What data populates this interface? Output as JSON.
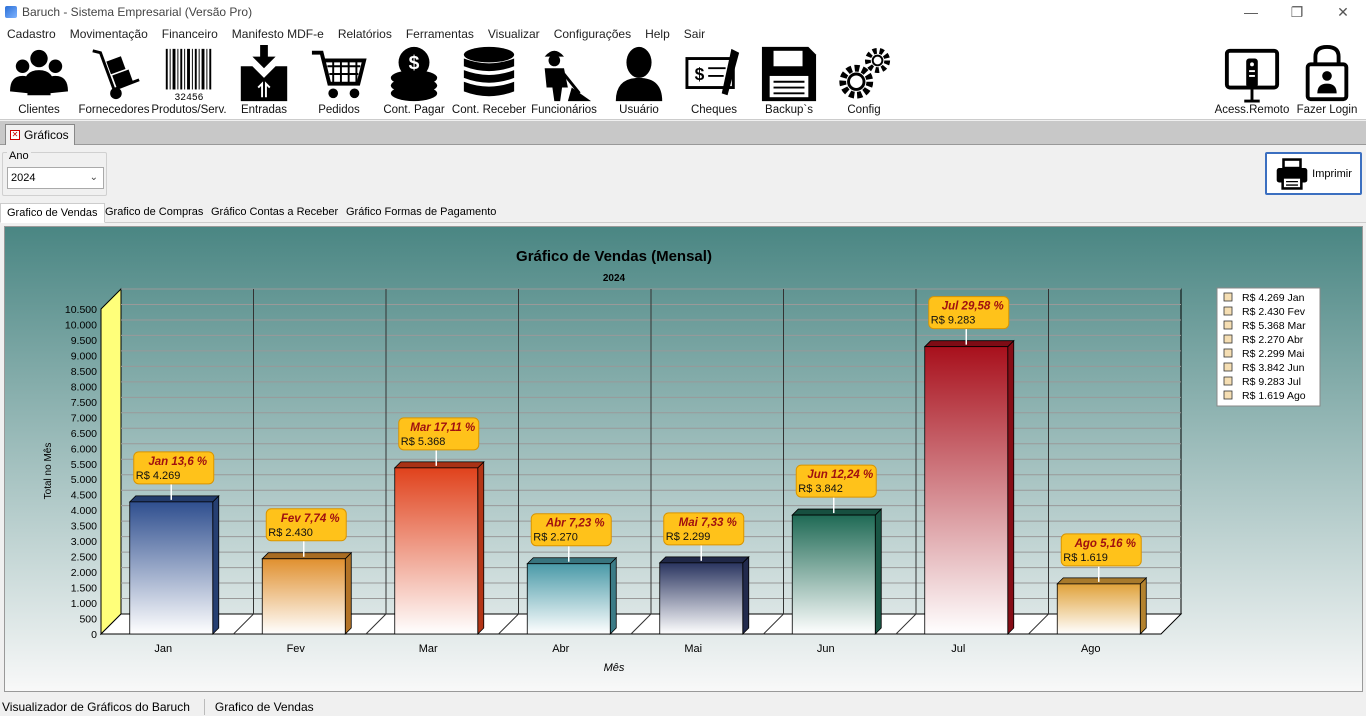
{
  "window": {
    "title": "Baruch - Sistema Empresarial (Versão Pro)"
  },
  "menu": [
    "Cadastro",
    "Movimentação",
    "Financeiro",
    "Manifesto MDF-e",
    "Relatórios",
    "Ferramentas",
    "Visualizar",
    "Configurações",
    "Help",
    "Sair"
  ],
  "toolbar": {
    "clientes": "Clientes",
    "fornecedores": "Fornecedores",
    "produtos": "Produtos/Serv.",
    "barcode_digits": "32456",
    "entradas": "Entradas",
    "pedidos": "Pedidos",
    "cont_pagar": "Cont. Pagar",
    "cont_receber": "Cont. Receber",
    "funcionarios": "Funcionários",
    "usuario": "Usuário",
    "cheques": "Cheques",
    "backup": "Backup`s",
    "config": "Config",
    "acesso_remoto": "Acess.Remoto",
    "fazer_login": "Fazer Login"
  },
  "doc_tab": "Gráficos",
  "year": {
    "label": "Ano",
    "value": "2024"
  },
  "print_label": "Imprimir",
  "chart_tabs": [
    "Grafico de Vendas",
    "Grafico de Compras",
    "Gráfico Contas a Receber",
    "Gráfico Formas de Pagamento"
  ],
  "status": {
    "left": "Visualizador de Gráficos do Baruch",
    "right": "Grafico de Vendas"
  },
  "colors": {
    "panel_top": "#4f8f8c",
    "panel_bottom": "#f7f8f8",
    "wall": "#ffff7a"
  },
  "chart_data": {
    "type": "bar",
    "title": "Gráfico de Vendas (Mensal)",
    "subtitle": "2024",
    "xlabel": "Mês",
    "ylabel": "Total no Mês",
    "ylim": [
      0,
      10500
    ],
    "yticks": [
      "0",
      "500",
      "1.000",
      "1.500",
      "2.000",
      "2.500",
      "3.000",
      "3.500",
      "4.000",
      "4.500",
      "5.000",
      "5.500",
      "6.000",
      "6.500",
      "7.000",
      "7.500",
      "8.000",
      "8.500",
      "9.000",
      "9.500",
      "10.000",
      "10.500"
    ],
    "categories": [
      "Jan",
      "Fev",
      "Mar",
      "Abr",
      "Mai",
      "Jun",
      "Jul",
      "Ago"
    ],
    "values": [
      4269,
      2430,
      5368,
      2270,
      2299,
      3842,
      9283,
      1619
    ],
    "value_labels": [
      "R$ 4.269",
      "R$ 2.430",
      "R$ 5.368",
      "R$ 2.270",
      "R$ 2.299",
      "R$ 3.842",
      "R$ 9.283",
      "R$ 1.619"
    ],
    "percent_labels": [
      "Jan 13,6 %",
      "Fev 7,74 %",
      "Mar 17,11 %",
      "Abr 7,23 %",
      "Mai 7,33 %",
      "Jun 12,24 %",
      "Jul 29,58 %",
      "Ago 5,16 %"
    ],
    "legend": [
      "R$ 4.269 Jan",
      "R$ 2.430 Fev",
      "R$ 5.368 Mar",
      "R$ 2.270 Abr",
      "R$ 2.299 Mai",
      "R$ 3.842 Jun",
      "R$ 9.283 Jul",
      "R$ 1.619 Ago"
    ],
    "legend_position": "top-right",
    "bar_colors": [
      "#2f4f8f",
      "#e0902f",
      "#e0421c",
      "#4a9aa8",
      "#2a3560",
      "#1f6a55",
      "#a8101c",
      "#e0a23a"
    ],
    "grid": true
  }
}
